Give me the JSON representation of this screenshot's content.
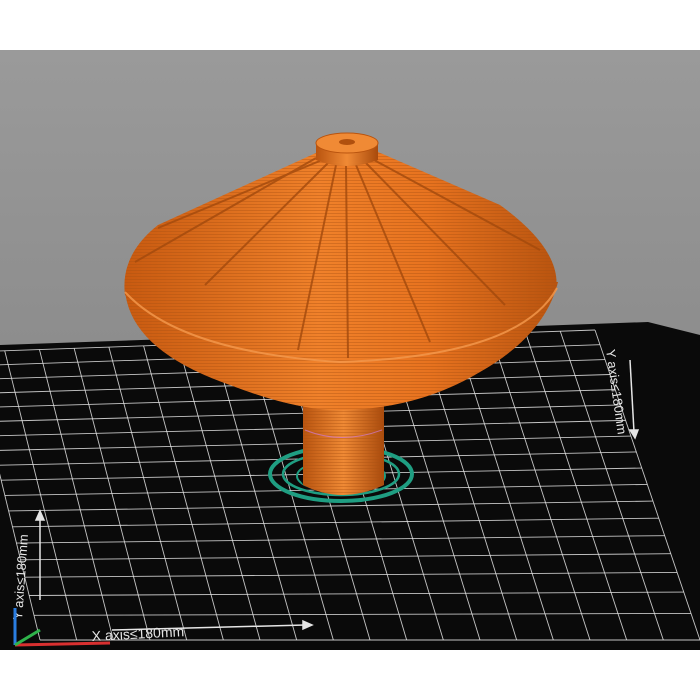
{
  "viewport": {
    "background_color": "#8f8f8f",
    "bed_color": "#0a0a0a",
    "grid_color": "#e6e6e6",
    "model_color": "#e8731f",
    "skirt_color": "#1f9e82",
    "x_axis_label": "X axis≤180mm",
    "y_axis_label": "Y axis≤180mm",
    "y_axis_label_left": "Y axis≤180mm"
  },
  "icons": {
    "axes_gizmo": "xyz-axes-icon"
  }
}
